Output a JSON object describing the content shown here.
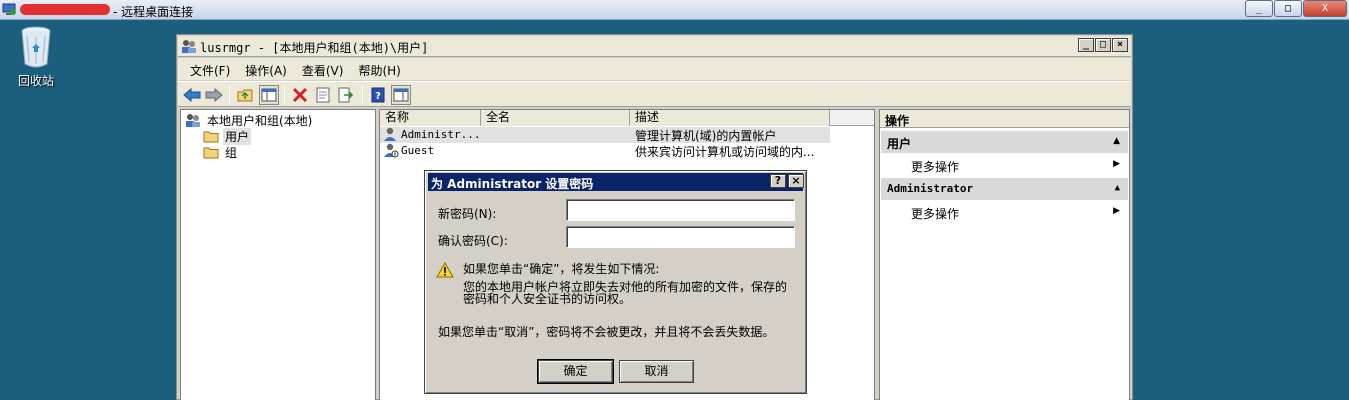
{
  "rdp": {
    "title": "- 远程桌面连接",
    "controls": {
      "minimize": "_",
      "restore": "□",
      "close": "X"
    }
  },
  "desktop": {
    "recycle_bin_label": "回收站"
  },
  "window": {
    "title": "lusrmgr - [本地用户和组(本地)\\用户]",
    "controls": {
      "minimize": "_",
      "restore": "□",
      "close": "×"
    },
    "menu": [
      "文件(F)",
      "操作(A)",
      "查看(V)",
      "帮助(H)"
    ]
  },
  "tree": {
    "root": "本地用户和组(本地)",
    "items": [
      "用户",
      "组"
    ]
  },
  "list": {
    "columns": [
      "名称",
      "全名",
      "描述"
    ],
    "rows": [
      {
        "name": "Administr...",
        "fullname": "",
        "desc": "管理计算机(域)的内置帐户"
      },
      {
        "name": "Guest",
        "fullname": "",
        "desc": "供来宾访问计算机或访问域的内..."
      }
    ]
  },
  "actions": {
    "header": "操作",
    "sections": [
      {
        "title": "用户",
        "item": "更多操作"
      },
      {
        "title": "Administrator",
        "item": "更多操作"
      }
    ]
  },
  "dialog": {
    "title": "为 Administrator 设置密码",
    "help": "?",
    "close": "×",
    "new_password_label": "新密码(N):",
    "new_password_value": "",
    "confirm_password_label": "确认密码(C):",
    "confirm_password_value": "",
    "warning_heading": "如果您单击“确定”，将发生如下情况:",
    "warning_line1": "您的本地用户帐户将立即失去对他的所有加密的文件，保存的",
    "warning_line2": "密码和个人安全证书的访问权。",
    "cancel_note": "如果您单击“取消”，密码将不会被更改，并且将不会丢失数据。",
    "ok_label": "确定",
    "cancel_label": "取消"
  },
  "colors": {
    "desktop": "#1b5e7e",
    "dialog_title": "#0a246a",
    "delete_icon": "#d42020",
    "help_icon": "#2b4fb0"
  }
}
